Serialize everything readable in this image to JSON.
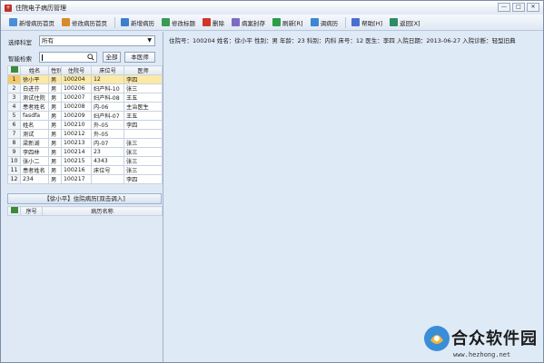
{
  "window": {
    "title": "住院电子病历管理",
    "ctrls": [
      "—",
      "□",
      "✕"
    ]
  },
  "toolbar": {
    "items": [
      {
        "label": "新增病历首页",
        "color": "#4a8fd6"
      },
      {
        "label": "修改病历首页",
        "color": "#d98a2b"
      },
      {
        "label": "新增病历",
        "color": "#3b7fd0"
      },
      {
        "label": "修改标题",
        "color": "#3a9a52"
      },
      {
        "label": "删除",
        "color": "#d0352d"
      },
      {
        "label": "病案封存",
        "color": "#7e6ac2"
      },
      {
        "label": "刷新[R]",
        "color": "#2f9c4a"
      },
      {
        "label": "调病历",
        "color": "#3c87cf"
      },
      {
        "label": "帮助[H]",
        "color": "#4a6fd0"
      },
      {
        "label": "返回[X]",
        "color": "#2e8c62"
      }
    ]
  },
  "filter": {
    "dept_label": "选择科室",
    "dept_value": "所有",
    "search_label": "智能检索",
    "all_button": "全部",
    "local_doctor_button": "本医师"
  },
  "patients": {
    "columns": [
      "姓名",
      "性别",
      "住院号",
      "床位号",
      "医师"
    ],
    "rows": [
      {
        "n": "1",
        "name": "徐小平",
        "sex": "男",
        "id": "100204",
        "bed": "12",
        "doctor": "李四"
      },
      {
        "n": "2",
        "name": "白进芬",
        "sex": "男",
        "id": "100206",
        "bed": "妇产科-10",
        "doctor": "张三"
      },
      {
        "n": "3",
        "name": "测试住院",
        "sex": "男",
        "id": "100207",
        "bed": "妇产科-08",
        "doctor": "王五"
      },
      {
        "n": "4",
        "name": "患者姓名",
        "sex": "男",
        "id": "100208",
        "bed": "内-06",
        "doctor": "主治医生"
      },
      {
        "n": "5",
        "name": "fasdfa",
        "sex": "男",
        "id": "100209",
        "bed": "妇产科-07",
        "doctor": "王五"
      },
      {
        "n": "6",
        "name": "姓名",
        "sex": "男",
        "id": "100210",
        "bed": "外-05",
        "doctor": "李四"
      },
      {
        "n": "7",
        "name": "测试",
        "sex": "男",
        "id": "100212",
        "bed": "外-05",
        "doctor": ""
      },
      {
        "n": "8",
        "name": "梁新湖",
        "sex": "男",
        "id": "100213",
        "bed": "内-07",
        "doctor": "张三"
      },
      {
        "n": "9",
        "name": "李四林",
        "sex": "男",
        "id": "100214",
        "bed": "23",
        "doctor": "张三"
      },
      {
        "n": "10",
        "name": "张小二",
        "sex": "男",
        "id": "100215",
        "bed": "4343",
        "doctor": "张三"
      },
      {
        "n": "11",
        "name": "患者姓名",
        "sex": "男",
        "id": "100216",
        "bed": "床位号",
        "doctor": "张三"
      },
      {
        "n": "12",
        "name": "234",
        "sex": "男",
        "id": "100217",
        "bed": "",
        "doctor": "李四"
      }
    ]
  },
  "records": {
    "header": "【徐小平】住院病历[双击调入]",
    "columns": [
      "序号",
      "病历名称"
    ]
  },
  "detail": {
    "patient_line": "住院号：100204   姓名：徐小平   性别：男   年龄：23   科别：内科   床号：12   医生：李四   入院日期：2013-06-27   入院诊断：轻型旧典"
  },
  "watermark": {
    "text": "合众软件园",
    "url": "www.hezhong.net"
  }
}
